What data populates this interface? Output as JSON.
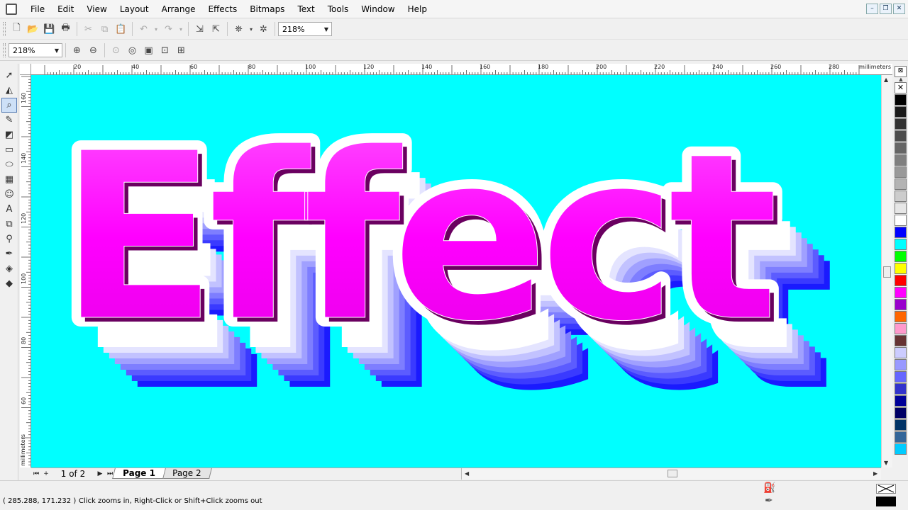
{
  "menu": [
    "File",
    "Edit",
    "View",
    "Layout",
    "Arrange",
    "Effects",
    "Bitmaps",
    "Text",
    "Tools",
    "Window",
    "Help"
  ],
  "window_controls": {
    "minimize": "–",
    "restore": "❐",
    "close": "✕"
  },
  "toolbar": {
    "zoom_value": "218%"
  },
  "property_bar": {
    "zoom_value": "218%"
  },
  "ruler": {
    "units": "millimeters",
    "top_labels": [
      "20",
      "40",
      "60",
      "80",
      "100",
      "120",
      "140",
      "160",
      "180",
      "200",
      "220",
      "240",
      "260",
      "280"
    ],
    "left_labels": [
      "160",
      "140",
      "120",
      "100",
      "80",
      "60"
    ]
  },
  "canvas": {
    "background": "#00ffff",
    "artwork_text": "Effect",
    "text_fill": "#ff00ff",
    "extrude_color": "#1a1aff"
  },
  "page_nav": {
    "count": "1 of 2",
    "tabs": [
      "Page 1",
      "Page 2"
    ],
    "active_tab": "Page 1"
  },
  "palette": [
    "#000000",
    "#1a1a1a",
    "#333333",
    "#4d4d4d",
    "#666666",
    "#808080",
    "#999999",
    "#b3b3b3",
    "#cccccc",
    "#e6e6e6",
    "#ffffff",
    "#0000ff",
    "#00ffff",
    "#00ff00",
    "#ffff00",
    "#ff0000",
    "#ff00ff",
    "#9900cc",
    "#ff6600",
    "#ff99cc",
    "#663333",
    "#ccccff",
    "#9999ff",
    "#6666ff",
    "#3333cc",
    "#000099",
    "#000066",
    "#003366",
    "#336699",
    "#00ccff"
  ],
  "status": {
    "coords": "( 285.288, 171.232 )",
    "hint": "Click zooms in, Right-Click or Shift+Click zooms out"
  }
}
